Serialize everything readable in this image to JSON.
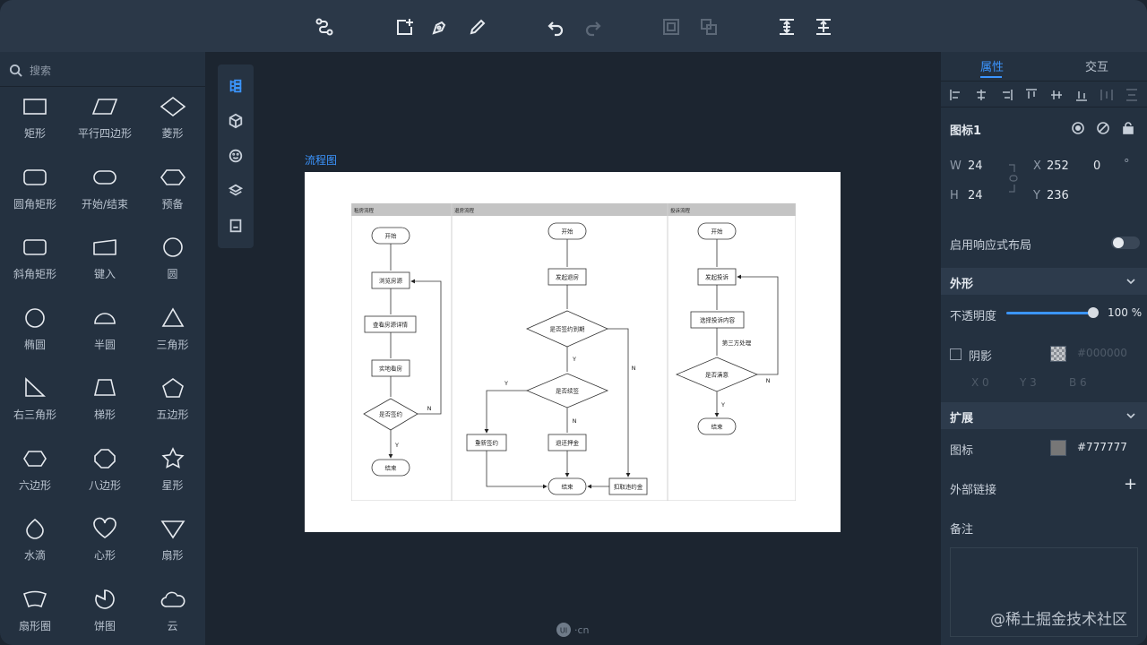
{
  "toolbar": {
    "buttons": [
      "connector-icon",
      "add-container-icon",
      "pen-icon",
      "pencil-icon",
      "undo-icon",
      "redo-icon",
      "group-icon",
      "ungroup-icon",
      "distribute-vertical-icon",
      "distribute-top-icon"
    ]
  },
  "library": {
    "search_placeholder": "搜索",
    "shapes": [
      {
        "label": "矩形",
        "icon": "rectangle"
      },
      {
        "label": "平行四边形",
        "icon": "parallelogram"
      },
      {
        "label": "菱形",
        "icon": "diamond"
      },
      {
        "label": "圆角矩形",
        "icon": "rounded-rectangle"
      },
      {
        "label": "开始/结束",
        "icon": "terminator"
      },
      {
        "label": "预备",
        "icon": "hexagon-preparation"
      },
      {
        "label": "斜角矩形",
        "icon": "bevel-rectangle"
      },
      {
        "label": "键入",
        "icon": "manual-input"
      },
      {
        "label": "圆",
        "icon": "circle"
      },
      {
        "label": "椭圆",
        "icon": "ellipse"
      },
      {
        "label": "半圆",
        "icon": "semicircle"
      },
      {
        "label": "三角形",
        "icon": "triangle"
      },
      {
        "label": "右三角形",
        "icon": "right-triangle"
      },
      {
        "label": "梯形",
        "icon": "trapezoid"
      },
      {
        "label": "五边形",
        "icon": "pentagon"
      },
      {
        "label": "六边形",
        "icon": "hexagon"
      },
      {
        "label": "八边形",
        "icon": "octagon"
      },
      {
        "label": "星形",
        "icon": "star"
      },
      {
        "label": "水滴",
        "icon": "drop"
      },
      {
        "label": "心形",
        "icon": "heart"
      },
      {
        "label": "扇形",
        "icon": "sector"
      },
      {
        "label": "扇形圈",
        "icon": "ring-sector"
      },
      {
        "label": "饼图",
        "icon": "pie"
      },
      {
        "label": "云",
        "icon": "cloud"
      }
    ]
  },
  "canvas": {
    "title": "流程图",
    "flowchart": {
      "lanes": [
        "租房流程",
        "退房流程",
        "投诉流程"
      ],
      "rent": {
        "start": "开始",
        "browse": "浏览房源",
        "detail": "查看房源详情",
        "visit": "实地看房",
        "sign": "是否签约",
        "end": "结束",
        "yes": "Y",
        "no": "N"
      },
      "checkout": {
        "start": "开始",
        "apply": "发起退房",
        "expired": "是否签约到期",
        "renew": "是否续签",
        "resign": "重新签约",
        "refund": "退还押金",
        "penalty": "扣取违约金",
        "end": "结束",
        "yes1": "Y",
        "yes2": "Y",
        "no1": "N",
        "no2": "N"
      },
      "complaint": {
        "start": "开始",
        "raise": "发起投诉",
        "choose": "选择投诉内容",
        "thirdparty": "第三方处理",
        "satisfied": "是否满意",
        "end": "结束",
        "yes": "Y",
        "no": "N"
      }
    }
  },
  "panel": {
    "tabs": [
      "属性",
      "交互"
    ],
    "icon_name": "图标1",
    "w_label": "W",
    "w": "24",
    "h_label": "H",
    "h": "24",
    "x_label": "X",
    "x": "252",
    "y_label": "Y",
    "y": "236",
    "rotation": "0",
    "degree": "°",
    "responsive": "启用响应式布局",
    "appearance": "外形",
    "opacity_label": "不透明度",
    "opacity": "100 %",
    "opacity_value": 1.0,
    "shadow_label": "阴影",
    "shadow_color": "#000000",
    "shadow_x": "X 0",
    "shadow_y": "Y 3",
    "shadow_b": "B 6",
    "extend": "扩展",
    "icon_label": "图标",
    "icon_color": "#777777",
    "link_label": "外部链接",
    "notes_label": "备注",
    "plus": "+"
  },
  "footer": {
    "logo": "·cn",
    "watermark": "@稀土掘金技术社区"
  },
  "colors": {
    "accent": "#3b95ff",
    "bg": "#1c2530",
    "panel": "#243140"
  }
}
